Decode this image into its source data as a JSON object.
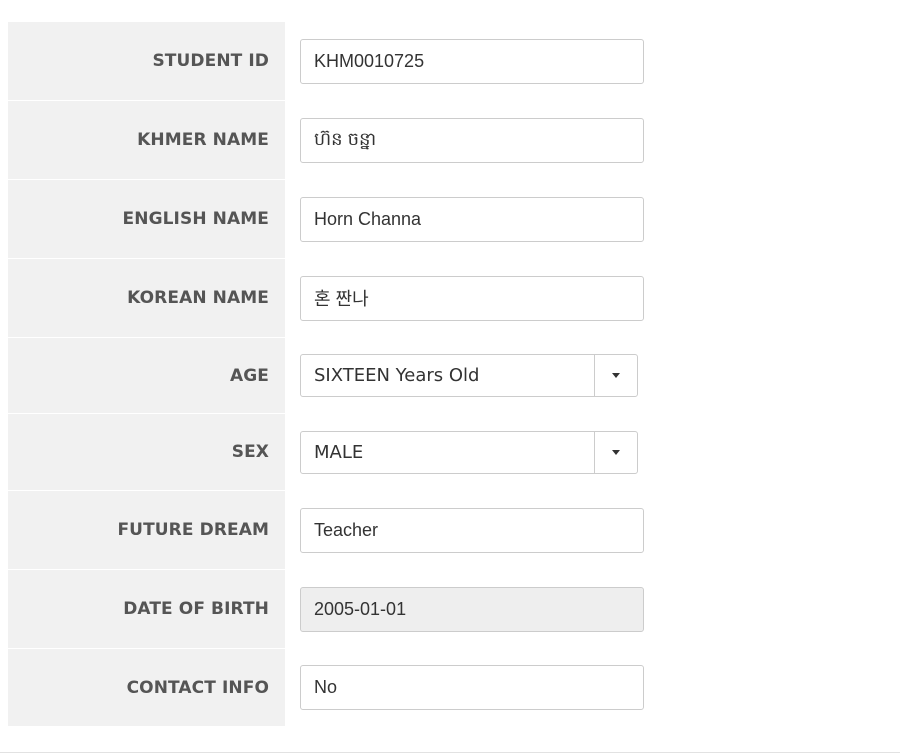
{
  "form": {
    "student_id": {
      "label": "STUDENT ID",
      "value": "KHM0010725"
    },
    "khmer_name": {
      "label": "KHMER NAME",
      "value": "ហ៊ន ចន្នា"
    },
    "english_name": {
      "label": "ENGLISH NAME",
      "value": "Horn Channa"
    },
    "korean_name": {
      "label": "KOREAN NAME",
      "value": "혼 짠나"
    },
    "age": {
      "label": "AGE",
      "selected": "SIXTEEN Years Old",
      "icon": "caret-down-icon"
    },
    "sex": {
      "label": "SEX",
      "selected": "MALE",
      "icon": "caret-down-icon"
    },
    "future_dream": {
      "label": "FUTURE DREAM",
      "value": "Teacher"
    },
    "date_of_birth": {
      "label": "DATE OF BIRTH",
      "value": "2005-01-01"
    },
    "contact_info": {
      "label": "CONTACT INFO",
      "value": "No"
    }
  },
  "colors": {
    "label_background": "#f1f1f1",
    "label_text": "#555555",
    "input_border": "#cccccc",
    "readonly_background": "#eeeeee"
  }
}
